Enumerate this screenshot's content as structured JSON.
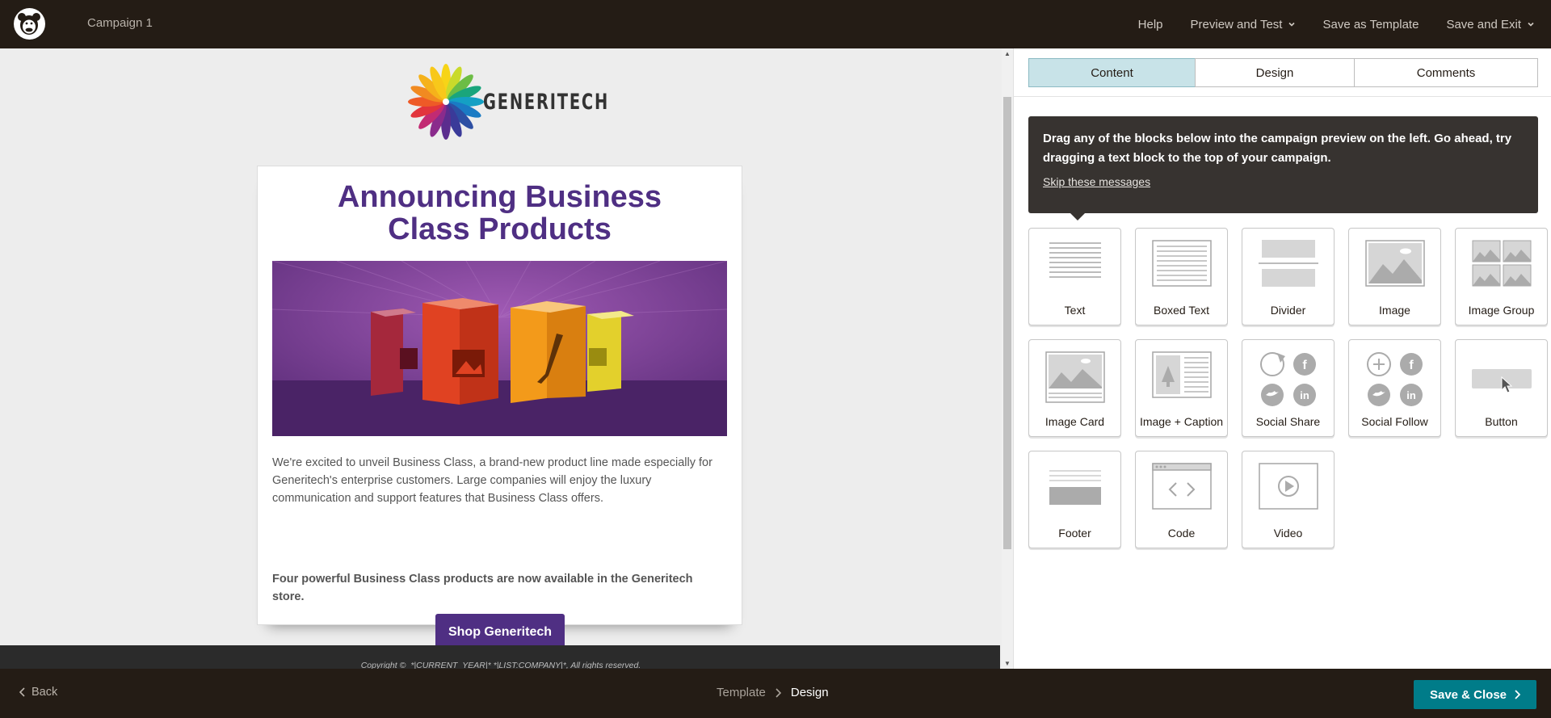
{
  "header": {
    "logo_icon": "mailchimp-freddie-icon",
    "campaign_name": "Campaign 1",
    "nav": [
      {
        "label": "Help",
        "caret": false
      },
      {
        "label": "Preview and Test",
        "caret": true
      },
      {
        "label": "Save as Template",
        "caret": false
      },
      {
        "label": "Save and Exit",
        "caret": true
      }
    ]
  },
  "email": {
    "brand_name": "GENERITECH",
    "headline_line1": "Announcing Business",
    "headline_line2": "Class Products",
    "hero_image": "product-boxes-image",
    "paragraph": "We're excited to unveil Business Class, a brand-new product line made especially for Generitech's enterprise customers. Large companies will enjoy the luxury communication and support features that Business Class offers.",
    "highlight": "Four powerful Business Class products are now available in the Generitech store.",
    "cta_label": "Shop Generitech",
    "copyright": "Copyright ©",
    "copyright_merge": "*|CURRENT_YEAR|* *|LIST:COMPANY|*, All rights reserved."
  },
  "panel": {
    "tabs": [
      {
        "label": "Content",
        "active": true
      },
      {
        "label": "Design",
        "active": false
      },
      {
        "label": "Comments",
        "active": false
      }
    ],
    "tooltip_text": "Drag any of the blocks below into the campaign preview on the left. Go ahead, try dragging a text block to the top of your campaign.",
    "tooltip_link": "Skip these messages",
    "blocks": [
      {
        "label": "Text",
        "icon": "text-block-icon"
      },
      {
        "label": "Boxed Text",
        "icon": "boxed-text-block-icon"
      },
      {
        "label": "Divider",
        "icon": "divider-block-icon"
      },
      {
        "label": "Image",
        "icon": "image-block-icon"
      },
      {
        "label": "Image Group",
        "icon": "image-group-block-icon"
      },
      {
        "label": "Image Card",
        "icon": "image-card-block-icon"
      },
      {
        "label": "Image + Caption",
        "icon": "image-caption-block-icon"
      },
      {
        "label": "Social Share",
        "icon": "social-share-block-icon"
      },
      {
        "label": "Social Follow",
        "icon": "social-follow-block-icon"
      },
      {
        "label": "Button",
        "icon": "button-block-icon"
      },
      {
        "label": "Footer",
        "icon": "footer-block-icon"
      },
      {
        "label": "Code",
        "icon": "code-block-icon"
      },
      {
        "label": "Video",
        "icon": "video-block-icon"
      }
    ]
  },
  "footer": {
    "back_label": "Back",
    "breadcrumb": [
      "Template",
      "Design"
    ],
    "save_close_label": "Save & Close"
  },
  "colors": {
    "topbar": "#241c15",
    "headline": "#4f2f83",
    "cta": "#4f2f83",
    "active_tab": "#c8e3e8",
    "save_close": "#007c89"
  }
}
